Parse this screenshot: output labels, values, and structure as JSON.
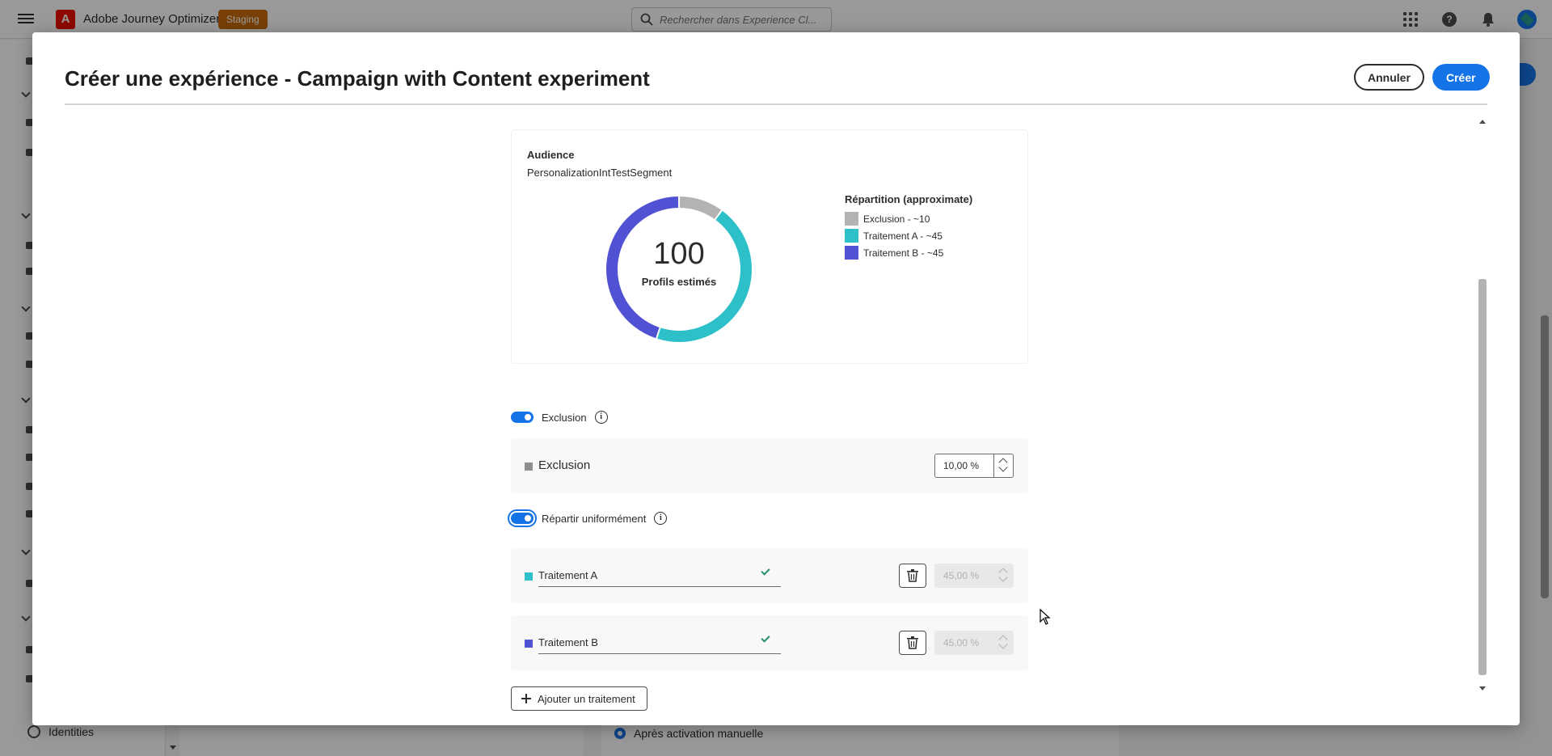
{
  "app": {
    "title": "Adobe Journey Optimizer",
    "environment_badge": "Staging",
    "search_placeholder": "Rechercher dans Experience Cl..."
  },
  "background": {
    "sidebar_identities_label": "Identities",
    "radio_label": "Après activation manuelle"
  },
  "modal": {
    "title": "Créer une expérience - Campaign with Content experiment",
    "cancel_label": "Annuler",
    "create_label": "Créer"
  },
  "audience": {
    "label": "Audience",
    "value": "PersonalizationIntTestSegment",
    "estimated_profiles": "100",
    "estimated_caption": "Profils estimés",
    "legend_title": "Répartition (approximate)",
    "segments": [
      {
        "label": "Exclusion - ~10",
        "value": 10,
        "color": "#b3b3b3"
      },
      {
        "label": "Traitement A - ~45",
        "value": 45,
        "color": "#2dc0c8"
      },
      {
        "label": "Traitement B - ~45",
        "value": 45,
        "color": "#5151d3"
      }
    ]
  },
  "exclusion_toggle": {
    "label": "Exclusion",
    "on": true
  },
  "exclusion": {
    "name": "Exclusion",
    "percent": "10,00 %",
    "color": "#8e8e8e"
  },
  "distribute_toggle": {
    "label": "Répartir uniformément",
    "on": true
  },
  "treatments": [
    {
      "name": "Traitement A",
      "percent": "45,00 %",
      "color": "#2dc0c8"
    },
    {
      "name": "Traitement B",
      "percent": "45,00 %",
      "color": "#5151d3"
    }
  ],
  "add_treatment_label": "Ajouter un traitement",
  "icons": {
    "menu": "hamburger-menu-icon",
    "search": "search-icon",
    "apps": "apps-grid-icon",
    "help": "help-icon",
    "notifications": "bell-icon",
    "info": "info-icon",
    "delete": "trash-icon",
    "valid": "checkmark-icon",
    "add": "plus-icon"
  }
}
